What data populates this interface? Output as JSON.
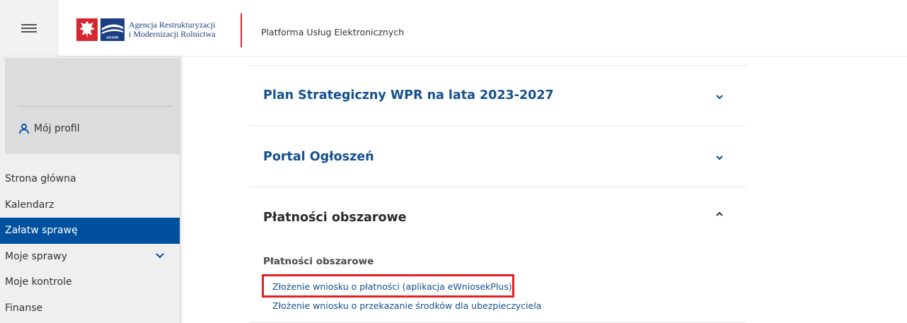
{
  "header": {
    "logo_line1": "Agencja Restrukturyzacji",
    "logo_line2": "i Modernizacji Rolnictwa",
    "logo_emblem_text": "ARiMR",
    "platform_title": "Platforma Usług Elektronicznych",
    "menu_icon": "hamburger-icon"
  },
  "sidebar": {
    "profile_label": "Mój profil",
    "profile_icon": "user-icon",
    "items": [
      {
        "label": "Strona główna",
        "active": false
      },
      {
        "label": "Kalendarz",
        "active": false
      },
      {
        "label": "Załatw sprawę",
        "active": true
      },
      {
        "label": "Moje sprawy",
        "active": false,
        "icon": "chevron-down-icon"
      },
      {
        "label": "Moje kontrole",
        "active": false
      },
      {
        "label": "Finanse",
        "active": false
      }
    ],
    "active_color": "#0050a0"
  },
  "main": {
    "sections": [
      {
        "title": "Plan Strategiczny WPR na lata 2023-2027",
        "expanded": false,
        "icon": "chevron-down-icon"
      },
      {
        "title": "Portal Ogłoszeń",
        "expanded": false,
        "icon": "chevron-down-icon"
      },
      {
        "title": "Płatności obszarowe",
        "expanded": true,
        "icon": "chevron-up-icon"
      }
    ],
    "expanded_subheading": "Płatności obszarowe",
    "links": [
      {
        "label": "Złożenie wniosku o płatności (aplikacja eWniosekPlus)",
        "highlighted": true
      },
      {
        "label": "Złożenie wniosku o przekazanie środków dla ubezpieczyciela",
        "highlighted": false
      }
    ],
    "link_color": "#144f8f",
    "highlight_color": "#e01f26"
  }
}
